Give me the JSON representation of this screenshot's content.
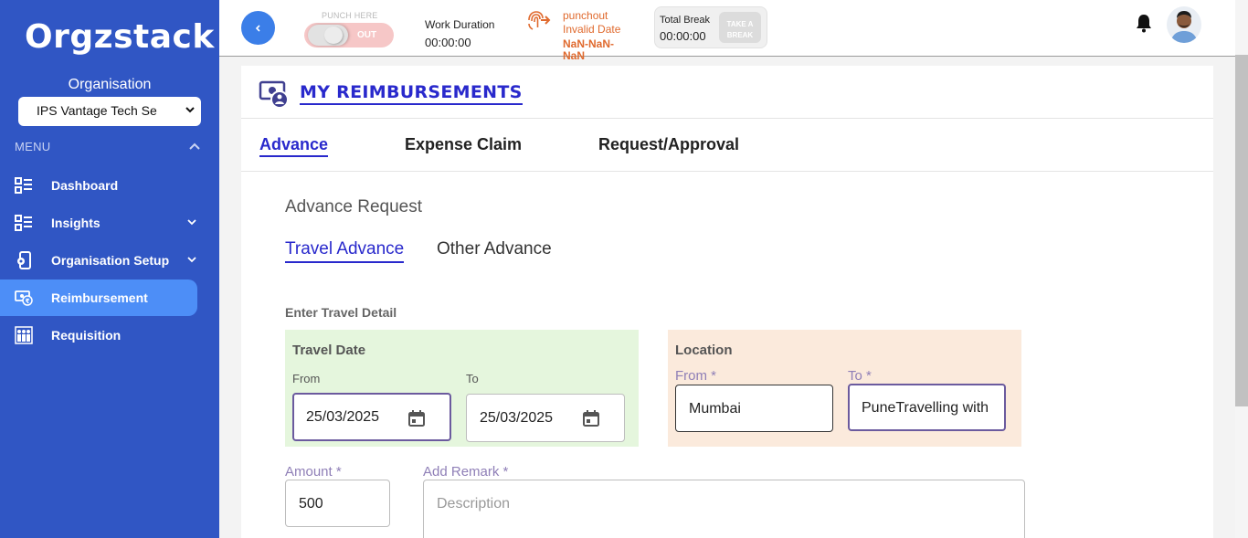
{
  "app": {
    "logo_text": "Orgzstack"
  },
  "sidebar": {
    "org_label": "Organisation",
    "org_selected": "IPS Vantage Tech Se",
    "menu_label": "MENU",
    "items": [
      {
        "label": "Dashboard",
        "icon": "list-icon"
      },
      {
        "label": "Insights",
        "icon": "list-icon"
      },
      {
        "label": "Organisation Setup",
        "icon": "phone-gear-icon"
      },
      {
        "label": "Reimbursement",
        "icon": "reimbursement-icon"
      },
      {
        "label": "Requisition",
        "icon": "requisition-icon"
      }
    ]
  },
  "topbar": {
    "punch_label": "PUNCH HERE",
    "punch_state": "OUT",
    "work_label": "Work Duration",
    "work_time": "00:00:00",
    "punch_status": "punchout",
    "punch_invalid": "Invalid Date",
    "punch_date": "NaN-NaN-NaN",
    "break_label": "Total Break",
    "break_time": "00:00:00",
    "break_btn": "TAKE A BREAK"
  },
  "page": {
    "title": "MY REIMBURSEMENTS",
    "tabs": [
      "Advance",
      "Expense Claim",
      "Request/Approval"
    ],
    "section_title": "Advance Request",
    "subtabs": [
      "Travel Advance",
      "Other Advance"
    ],
    "detail_label": "Enter Travel Detail"
  },
  "travel_date": {
    "title": "Travel Date",
    "from_label": "From",
    "to_label": "To",
    "from_value": "25/03/2025",
    "to_value": "25/03/2025"
  },
  "location": {
    "title": "Location",
    "from_label": "From *",
    "to_label": "To *",
    "from_value": "Mumbai",
    "to_value": "PuneTravelling with"
  },
  "amount": {
    "label": "Amount *",
    "value": "500"
  },
  "remark": {
    "label": "Add Remark *",
    "placeholder": "Description"
  },
  "colors": {
    "sidebar": "#3056c4",
    "active_nav": "#4d8ef7",
    "accent": "#2929cc",
    "date_bg": "#e5f6dd",
    "location_bg": "#fbeadc",
    "punch_orange": "#e06a2e"
  }
}
